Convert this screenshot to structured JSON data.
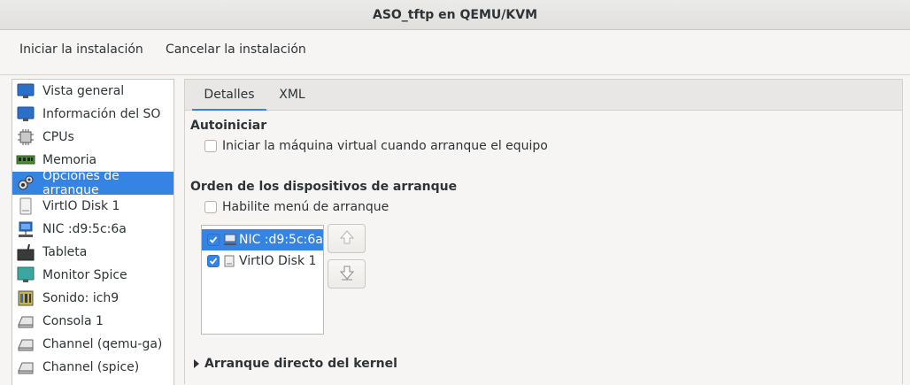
{
  "window": {
    "title": "ASO_tftp en QEMU/KVM"
  },
  "toolbar": {
    "begin_install": "Iniciar la instalación",
    "cancel_install": "Cancelar la instalación"
  },
  "sidebar": {
    "items": [
      {
        "label": "Vista general",
        "icon": "monitor-icon"
      },
      {
        "label": "Información del SO",
        "icon": "monitor-icon"
      },
      {
        "label": "CPUs",
        "icon": "cpu-icon"
      },
      {
        "label": "Memoria",
        "icon": "memory-icon"
      },
      {
        "label": "Opciones de arranque",
        "icon": "boot-gear-icon"
      },
      {
        "label": "VirtIO Disk 1",
        "icon": "disk-icon"
      },
      {
        "label": "NIC :d9:5c:6a",
        "icon": "network-icon"
      },
      {
        "label": "Tableta",
        "icon": "tablet-icon"
      },
      {
        "label": "Monitor Spice",
        "icon": "display-icon"
      },
      {
        "label": "Sonido: ich9",
        "icon": "sound-icon"
      },
      {
        "label": "Consola 1",
        "icon": "serial-icon"
      },
      {
        "label": "Channel (qemu-ga)",
        "icon": "serial-icon"
      },
      {
        "label": "Channel (spice)",
        "icon": "serial-icon"
      }
    ],
    "selected_index": 4
  },
  "tabs": {
    "details": "Detalles",
    "xml": "XML",
    "active": "Detalles"
  },
  "autostart": {
    "title": "Autoiniciar",
    "checkbox_label": "Iniciar la máquina virtual cuando arranque el equipo",
    "checked": false
  },
  "boot_order": {
    "title": "Orden de los dispositivos de arranque",
    "menu_label": "Habilite menú de arranque",
    "menu_checked": false,
    "devices": [
      {
        "label": "NIC :d9:5c:6a",
        "checked": true,
        "selected": true,
        "icon": "network-icon"
      },
      {
        "label": "VirtIO Disk 1",
        "checked": true,
        "selected": false,
        "icon": "disk-icon"
      }
    ]
  },
  "direct_kernel": {
    "title": "Arranque directo del kernel",
    "expanded": false
  },
  "colors": {
    "accent": "#3584e4",
    "background": "#f6f5f4"
  }
}
